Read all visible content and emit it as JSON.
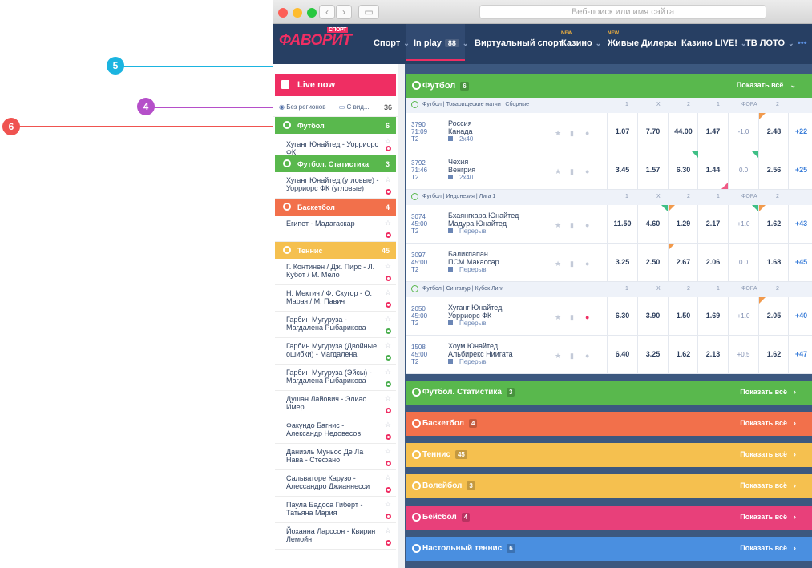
{
  "browser": {
    "url_placeholder": "Веб-поиск или имя сайта",
    "back": "‹",
    "forward": "›"
  },
  "nav": {
    "logo": "ФАВОРИТ",
    "logo_small": "СПОРТ",
    "items": [
      {
        "label": "Спорт",
        "chev": "⌄"
      },
      {
        "label": "In play",
        "count": "88",
        "chev": "⌄"
      },
      {
        "label": "Виртуальный спорт",
        "chev": "⌄"
      },
      {
        "label": "Казино",
        "new": "NEW",
        "chev": "⌄"
      },
      {
        "label": "Живые Дилеры",
        "new": "NEW"
      },
      {
        "label": "Казино LIVE!",
        "chev": "⌄"
      },
      {
        "label": "ТВ ЛОТО",
        "chev": "⌄"
      }
    ],
    "more": "•••"
  },
  "left": {
    "title": "Live now",
    "regions": "Без регионов",
    "with_video": "С вид...",
    "count": "36",
    "sections": [
      {
        "name": "Футбол",
        "count": "6",
        "color": "#59b84d",
        "matches": [
          {
            "title": "Хуганг Юнайтед - Уорриорс ФК",
            "status": "red",
            "star": true
          }
        ]
      },
      {
        "name": "Футбол. Статистика",
        "count": "3",
        "color": "#59b84d",
        "matches": [
          {
            "title": "Хуганг Юнайтед (угловые) - Уорриорс ФК (угловые)",
            "status": "red"
          }
        ]
      },
      {
        "name": "Баскетбол",
        "count": "4",
        "color": "#f2704b",
        "matches": [
          {
            "title": "Египет - Мадагаскар",
            "status": "red"
          }
        ]
      },
      {
        "name": "Теннис",
        "count": "45",
        "color": "#f5c04f",
        "matches": [
          {
            "title": "Г. Континен / Дж. Пирс - Л. Кубот / М. Мело",
            "status": "red"
          },
          {
            "title": "Н. Мектич / Ф. Скугор - О. Марач / М. Павич",
            "status": "red"
          },
          {
            "title": "Гарбин Мугуруза - Магдалена Рыбарикова",
            "status": "green"
          },
          {
            "title": "Гарбин Мугуруза (Двойные ошибки) - Магдалена",
            "status": "green"
          },
          {
            "title": "Гарбин Мугуруза (Эйсы) - Магдалена Рыбарикова",
            "status": "green"
          },
          {
            "title": "Душан Лайович - Элиас Имер",
            "status": "red"
          },
          {
            "title": "Факундо Багнис - Александр Недовесов",
            "status": "red"
          },
          {
            "title": "Даниэль Муньос Де Ла Нава - Стефано",
            "status": "red"
          },
          {
            "title": "Сальваторе Карузо - Алессандро Джианнесси",
            "status": "red"
          },
          {
            "title": "Паула Бадоса Гиберт - Татьяна Мария",
            "status": "red"
          },
          {
            "title": "Йоханна Ларссон - Квирин Лемойн",
            "status": "red"
          }
        ]
      }
    ]
  },
  "main": {
    "football": {
      "title": "Футбол",
      "count": "6",
      "show": "Показать всё",
      "show_arrow": "⌄"
    },
    "leagues": [
      {
        "name": "Футбол | Товарищеские матчи | Сборные",
        "heads": [
          "1",
          "X",
          "2",
          "1",
          "ФОРА",
          "2"
        ],
        "events": [
          {
            "code": "3790",
            "time": "71:09",
            "half": "Т2",
            "t1": "Россия",
            "t2": "Канада",
            "sub": "2x40",
            "odds": [
              "1.07",
              "7.70",
              "44.00",
              "1.47",
              "-1.0",
              "2.48",
              "+22"
            ]
          },
          {
            "code": "3792",
            "time": "71:46",
            "half": "Т2",
            "t1": "Чехия",
            "t2": "Венгрия",
            "sub": "2x40",
            "odds": [
              "3.45",
              "1.57",
              "6.30",
              "1.44",
              "0.0",
              "2.56",
              "+25"
            ]
          }
        ]
      },
      {
        "name": "Футбол | Индонезия | Лига 1",
        "heads": [
          "1",
          "X",
          "2",
          "1",
          "ФОРА",
          "2"
        ],
        "events": [
          {
            "code": "3074",
            "time": "45:00",
            "half": "Т2",
            "t1": "Бхаянгкара Юнайтед",
            "t2": "Мадура Юнайтед",
            "sub": "Перерыв",
            "odds": [
              "11.50",
              "4.60",
              "1.29",
              "2.17",
              "+1.0",
              "1.62",
              "+43"
            ]
          },
          {
            "code": "3097",
            "time": "45:00",
            "half": "Т2",
            "t1": "Баликпапан",
            "t2": "ПСМ Макассар",
            "sub": "Перерыв",
            "odds": [
              "3.25",
              "2.50",
              "2.67",
              "2.06",
              "0.0",
              "1.68",
              "+45"
            ]
          }
        ]
      },
      {
        "name": "Футбол | Сингапур | Кубок Лиги",
        "heads": [
          "1",
          "X",
          "2",
          "1",
          "ФОРА",
          "2"
        ],
        "events": [
          {
            "code": "2050",
            "time": "45:00",
            "half": "Т2",
            "t1": "Хуганг Юнайтед",
            "t2": "Уорриорс ФК",
            "sub": "Перерыв",
            "odds": [
              "6.30",
              "3.90",
              "1.50",
              "1.69",
              "+1.0",
              "2.05",
              "+40"
            ]
          },
          {
            "code": "1508",
            "time": "45:00",
            "half": "Т2",
            "t1": "Хоум Юнайтед",
            "t2": "Альбирекс Ниигата",
            "sub": "Перерыв",
            "odds": [
              "6.40",
              "3.25",
              "1.62",
              "2.13",
              "+0.5",
              "1.62",
              "+47"
            ]
          }
        ]
      }
    ],
    "collapsed": [
      {
        "title": "Футбол. Статистика",
        "count": "3",
        "color": "#59b84d"
      },
      {
        "title": "Баскетбол",
        "count": "4",
        "color": "#f2704b"
      },
      {
        "title": "Теннис",
        "count": "45",
        "color": "#f5c04f"
      },
      {
        "title": "Волейбол",
        "count": "3",
        "color": "#f5c04f"
      },
      {
        "title": "Бейсбол",
        "count": "4",
        "color": "#e8407a"
      },
      {
        "title": "Настольный теннис",
        "count": "6",
        "color": "#4a8fe0"
      }
    ],
    "show_all": "Показать всё",
    "arrow": "›"
  },
  "callouts": [
    {
      "n": "4",
      "color": "#b54fc9"
    },
    {
      "n": "5",
      "color": "#1bb4e0"
    },
    {
      "n": "6",
      "color": "#ef5350"
    }
  ]
}
